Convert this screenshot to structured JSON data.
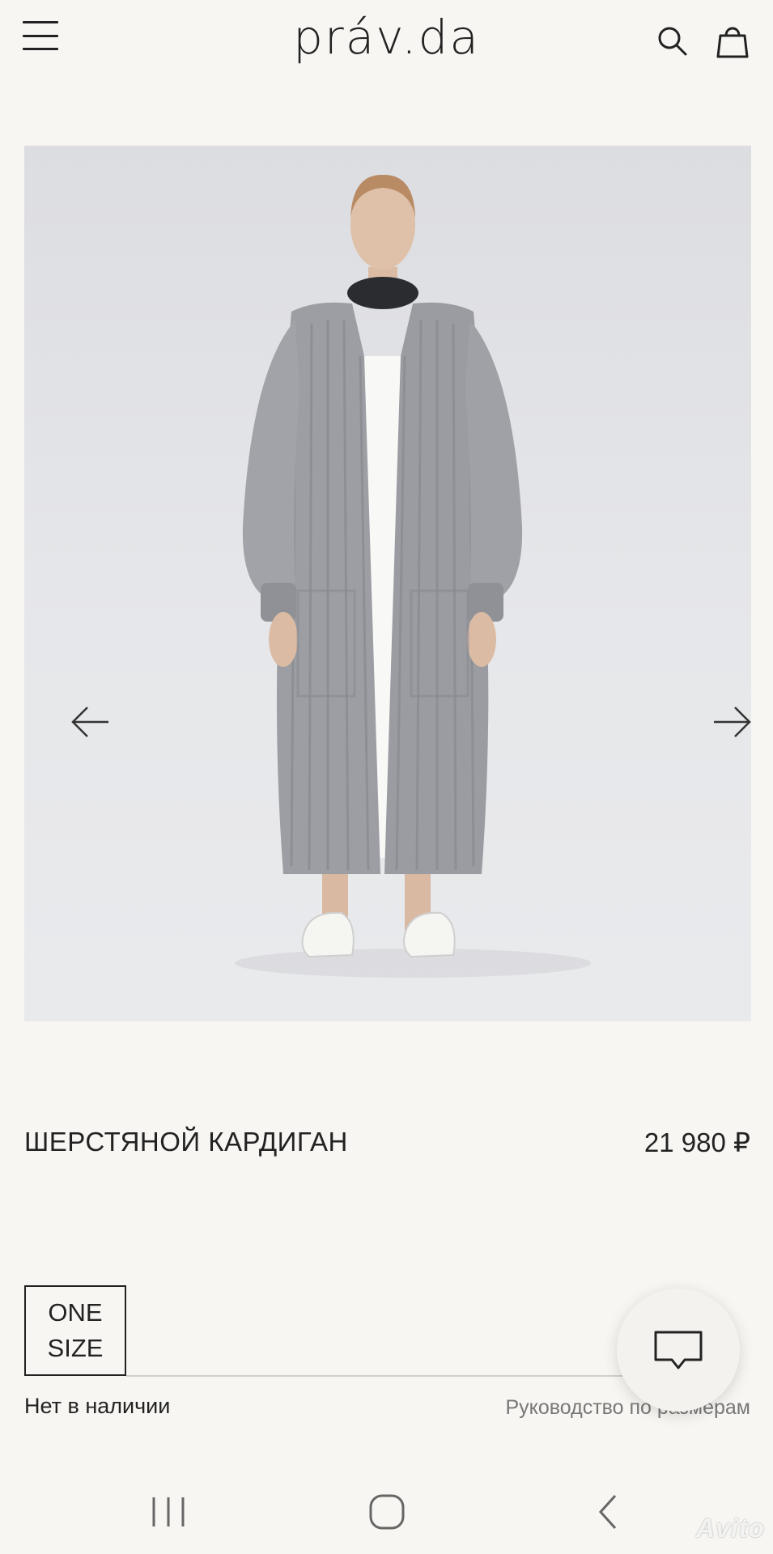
{
  "header": {
    "logo": "práv.da",
    "menu_icon": "hamburger-menu-icon",
    "search_icon": "search-icon",
    "cart_icon": "shopping-bag-icon"
  },
  "gallery": {
    "prev_icon": "arrow-left-icon",
    "next_icon": "arrow-right-icon",
    "background_color": "#e3e4e7"
  },
  "product": {
    "title": "ШЕРСТЯНОЙ КАРДИГАН",
    "price": "21 980 ₽"
  },
  "size": {
    "options": [
      "ONE SIZE"
    ],
    "line1": "ONE",
    "line2": "SIZE",
    "stock_status": "Нет в наличии",
    "size_guide_link": "Руководство по размерам"
  },
  "chat": {
    "icon": "chat-bubble-icon"
  },
  "system_nav": {
    "recent_icon": "recent-apps-icon",
    "home_icon": "home-icon",
    "back_icon": "back-icon"
  },
  "watermark": {
    "text": "Avito"
  }
}
